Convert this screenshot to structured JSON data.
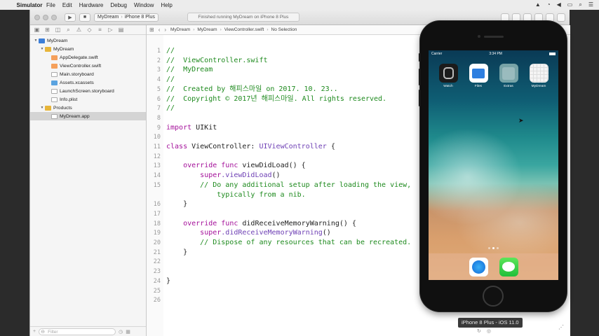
{
  "menubar": {
    "app_name": "Simulator",
    "items": [
      "File",
      "Edit",
      "Hardware",
      "Debug",
      "Window",
      "Help"
    ]
  },
  "toolbar": {
    "scheme_target": "MyDream",
    "scheme_device": "iPhone 8 Plus",
    "activity_status": "Finished running MyDream on iPhone 8 Plus"
  },
  "jumpbar": {
    "crumbs": [
      "MyDream",
      "MyDream",
      "ViewController.swift",
      "No Selection"
    ]
  },
  "navigator": {
    "filter_placeholder": "Filter",
    "items": [
      {
        "label": "MyDream",
        "indent": 0,
        "kind": "proj",
        "disclosure": "▼"
      },
      {
        "label": "MyDream",
        "indent": 1,
        "kind": "folder",
        "disclosure": "▼"
      },
      {
        "label": "AppDelegate.swift",
        "indent": 2,
        "kind": "swift",
        "disclosure": ""
      },
      {
        "label": "ViewController.swift",
        "indent": 2,
        "kind": "swift",
        "disclosure": ""
      },
      {
        "label": "Main.storyboard",
        "indent": 2,
        "kind": "file",
        "disclosure": ""
      },
      {
        "label": "Assets.xcassets",
        "indent": 2,
        "kind": "assets",
        "disclosure": ""
      },
      {
        "label": "LaunchScreen.storyboard",
        "indent": 2,
        "kind": "file",
        "disclosure": ""
      },
      {
        "label": "Info.plist",
        "indent": 2,
        "kind": "file",
        "disclosure": ""
      },
      {
        "label": "Products",
        "indent": 1,
        "kind": "folder",
        "disclosure": "▼"
      },
      {
        "label": "MyDream.app",
        "indent": 2,
        "kind": "file",
        "disclosure": "",
        "selected": true
      }
    ]
  },
  "editor": {
    "lines": [
      {
        "n": "1",
        "parts": [
          [
            "c-com",
            "//"
          ]
        ]
      },
      {
        "n": "2",
        "parts": [
          [
            "c-com",
            "//  ViewController.swift"
          ]
        ]
      },
      {
        "n": "3",
        "parts": [
          [
            "c-com",
            "//  MyDream"
          ]
        ]
      },
      {
        "n": "4",
        "parts": [
          [
            "c-com",
            "//"
          ]
        ]
      },
      {
        "n": "5",
        "parts": [
          [
            "c-com",
            "//  Created by 해피스마일 on 2017. 10. 23.."
          ]
        ]
      },
      {
        "n": "6",
        "parts": [
          [
            "c-com",
            "//  Copyright © 2017년 해피스마일. All rights reserved."
          ]
        ]
      },
      {
        "n": "7",
        "parts": [
          [
            "c-com",
            "//"
          ]
        ]
      },
      {
        "n": "8",
        "parts": []
      },
      {
        "n": "9",
        "parts": [
          [
            "c-kw",
            "import"
          ],
          [
            "c-fn",
            " UIKit"
          ]
        ]
      },
      {
        "n": "10",
        "parts": []
      },
      {
        "n": "11",
        "parts": [
          [
            "c-kw",
            "class"
          ],
          [
            "c-fn",
            " ViewController: "
          ],
          [
            "c-type",
            "UIViewController"
          ],
          [
            "c-fn",
            " {"
          ]
        ]
      },
      {
        "n": "12",
        "parts": []
      },
      {
        "n": "13",
        "parts": [
          [
            "c-fn",
            "    "
          ],
          [
            "c-kw",
            "override func"
          ],
          [
            "c-fn",
            " viewDidLoad() {"
          ]
        ]
      },
      {
        "n": "14",
        "parts": [
          [
            "c-fn",
            "        "
          ],
          [
            "c-kw",
            "super"
          ],
          [
            "c-type",
            ".viewDidLoad"
          ],
          [
            "c-fn",
            "()"
          ]
        ]
      },
      {
        "n": "15",
        "parts": [
          [
            "c-com",
            "        // Do any additional setup after loading the view,"
          ]
        ]
      },
      {
        "n": "",
        "parts": [
          [
            "c-com",
            "            typically from a nib."
          ]
        ]
      },
      {
        "n": "16",
        "parts": [
          [
            "c-fn",
            "    }"
          ]
        ]
      },
      {
        "n": "17",
        "parts": []
      },
      {
        "n": "18",
        "parts": [
          [
            "c-fn",
            "    "
          ],
          [
            "c-kw",
            "override func"
          ],
          [
            "c-fn",
            " didReceiveMemoryWarning() {"
          ]
        ]
      },
      {
        "n": "19",
        "parts": [
          [
            "c-fn",
            "        "
          ],
          [
            "c-kw",
            "super"
          ],
          [
            "c-type",
            ".didReceiveMemoryWarning"
          ],
          [
            "c-fn",
            "()"
          ]
        ]
      },
      {
        "n": "20",
        "parts": [
          [
            "c-com",
            "        // Dispose of any resources that can be recreated."
          ]
        ]
      },
      {
        "n": "21",
        "parts": [
          [
            "c-fn",
            "    }"
          ]
        ]
      },
      {
        "n": "22",
        "parts": []
      },
      {
        "n": "23",
        "parts": []
      },
      {
        "n": "24",
        "parts": [
          [
            "c-fn",
            "}"
          ]
        ]
      },
      {
        "n": "25",
        "parts": []
      },
      {
        "n": "26",
        "parts": []
      }
    ]
  },
  "simulator": {
    "carrier": "Carrier",
    "time": "3:34 PM",
    "apps": [
      {
        "label": "Watch",
        "icon": "watch-icon",
        "cls": "watch"
      },
      {
        "label": "Files",
        "icon": "files-icon",
        "cls": "files"
      },
      {
        "label": "Extras",
        "icon": "extras-folder-icon",
        "cls": "extras"
      },
      {
        "label": "MyDream",
        "icon": "mydream-app-icon",
        "cls": "mydream"
      }
    ],
    "dock": [
      {
        "icon": "safari-icon",
        "cls": "safari"
      },
      {
        "icon": "messages-icon",
        "cls": "messages"
      }
    ],
    "device_label": "iPhone 8 Plus - iOS 11.0"
  }
}
